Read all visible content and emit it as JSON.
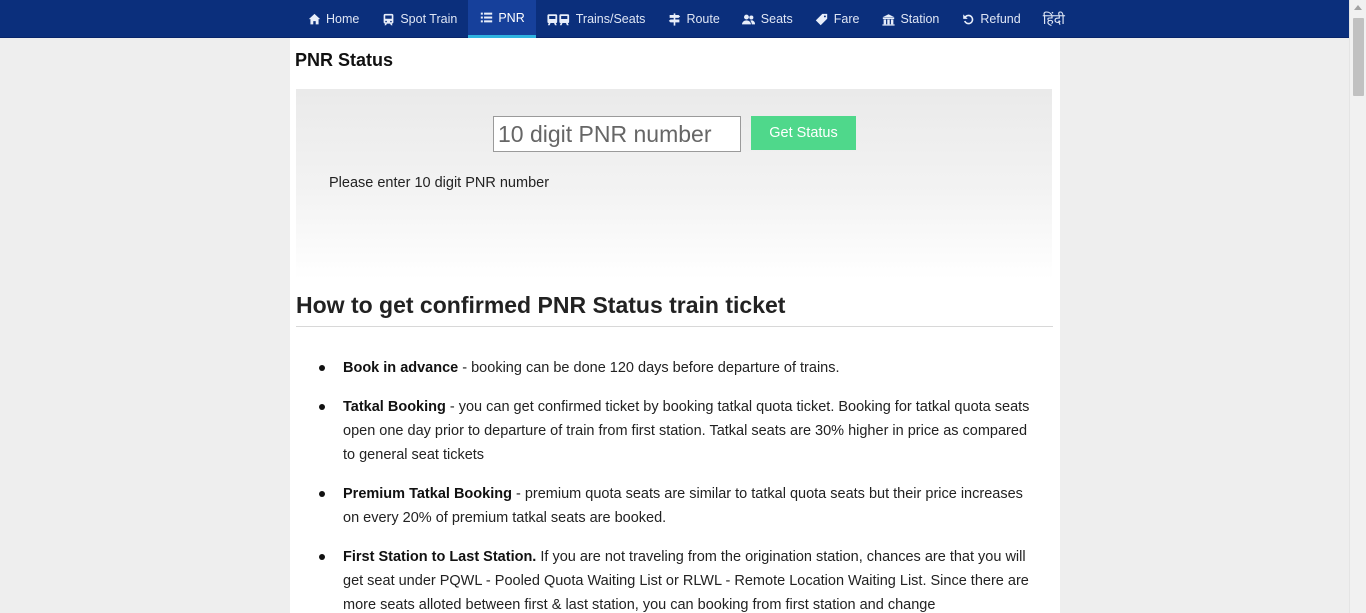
{
  "nav": {
    "items": [
      {
        "label": "Home",
        "icon": "home-icon",
        "active": false
      },
      {
        "label": "Spot Train",
        "icon": "train-icon",
        "active": false
      },
      {
        "label": "PNR",
        "icon": "list-icon",
        "active": true
      },
      {
        "label": "Trains/Seats",
        "icon": "trains-icon",
        "active": false
      },
      {
        "label": "Route",
        "icon": "signpost-icon",
        "active": false
      },
      {
        "label": "Seats",
        "icon": "users-icon",
        "active": false
      },
      {
        "label": "Fare",
        "icon": "tag-icon",
        "active": false
      },
      {
        "label": "Station",
        "icon": "station-icon",
        "active": false
      },
      {
        "label": "Refund",
        "icon": "undo-icon",
        "active": false
      },
      {
        "label": "हिंदी",
        "icon": "",
        "active": false
      }
    ]
  },
  "page": {
    "title": "PNR Status"
  },
  "pnr_form": {
    "placeholder": "10 digit PNR number",
    "value": "",
    "button_label": "Get Status",
    "hint": "Please enter 10 digit PNR number"
  },
  "guide": {
    "heading": "How to get confirmed PNR Status train ticket",
    "tips": [
      {
        "title": "Book in advance",
        "text": " - booking can be done 120 days before departure of trains."
      },
      {
        "title": "Tatkal Booking",
        "text": " - you can get confirmed ticket by booking tatkal quota ticket. Booking for tatkal quota seats open one day prior to departure of train from first station. Tatkal seats are 30% higher in price as compared to general seat tickets"
      },
      {
        "title": "Premium Tatkal Booking",
        "text": " - premium quota seats are similar to tatkal quota seats but their price increases on every 20% of premium tatkal seats are booked."
      },
      {
        "title": "First Station to Last Station.",
        "text": " If you are not traveling from the origination station, chances are that you will get seat under PQWL - Pooled Quota Waiting List or RLWL - Remote Location Waiting List. Since there are more seats alloted between first & last station, you can booking from first station and change"
      }
    ]
  },
  "colors": {
    "navbar": "#0b2f7c",
    "nav_active": "#16409b",
    "nav_active_underline": "#2fb3e0",
    "button": "#4fd88b",
    "page_bg": "#eeeeee"
  }
}
